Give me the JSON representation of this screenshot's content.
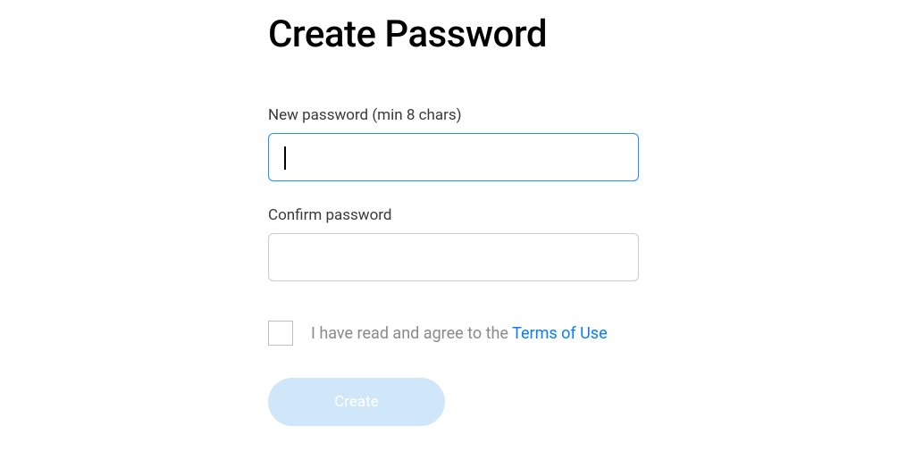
{
  "title": "Create Password",
  "fields": {
    "new_password": {
      "label": "New password (min 8 chars)",
      "value": ""
    },
    "confirm_password": {
      "label": "Confirm password",
      "value": ""
    }
  },
  "consent": {
    "checked": false,
    "text_prefix": "I have read and agree to the ",
    "link_text": "Terms of Use"
  },
  "button": {
    "label": "Create",
    "enabled": false
  },
  "colors": {
    "accent": "#1e90ff",
    "link": "#0a7cff",
    "button_disabled_bg": "#cfe7f8",
    "text_muted": "#8a8a8a"
  }
}
